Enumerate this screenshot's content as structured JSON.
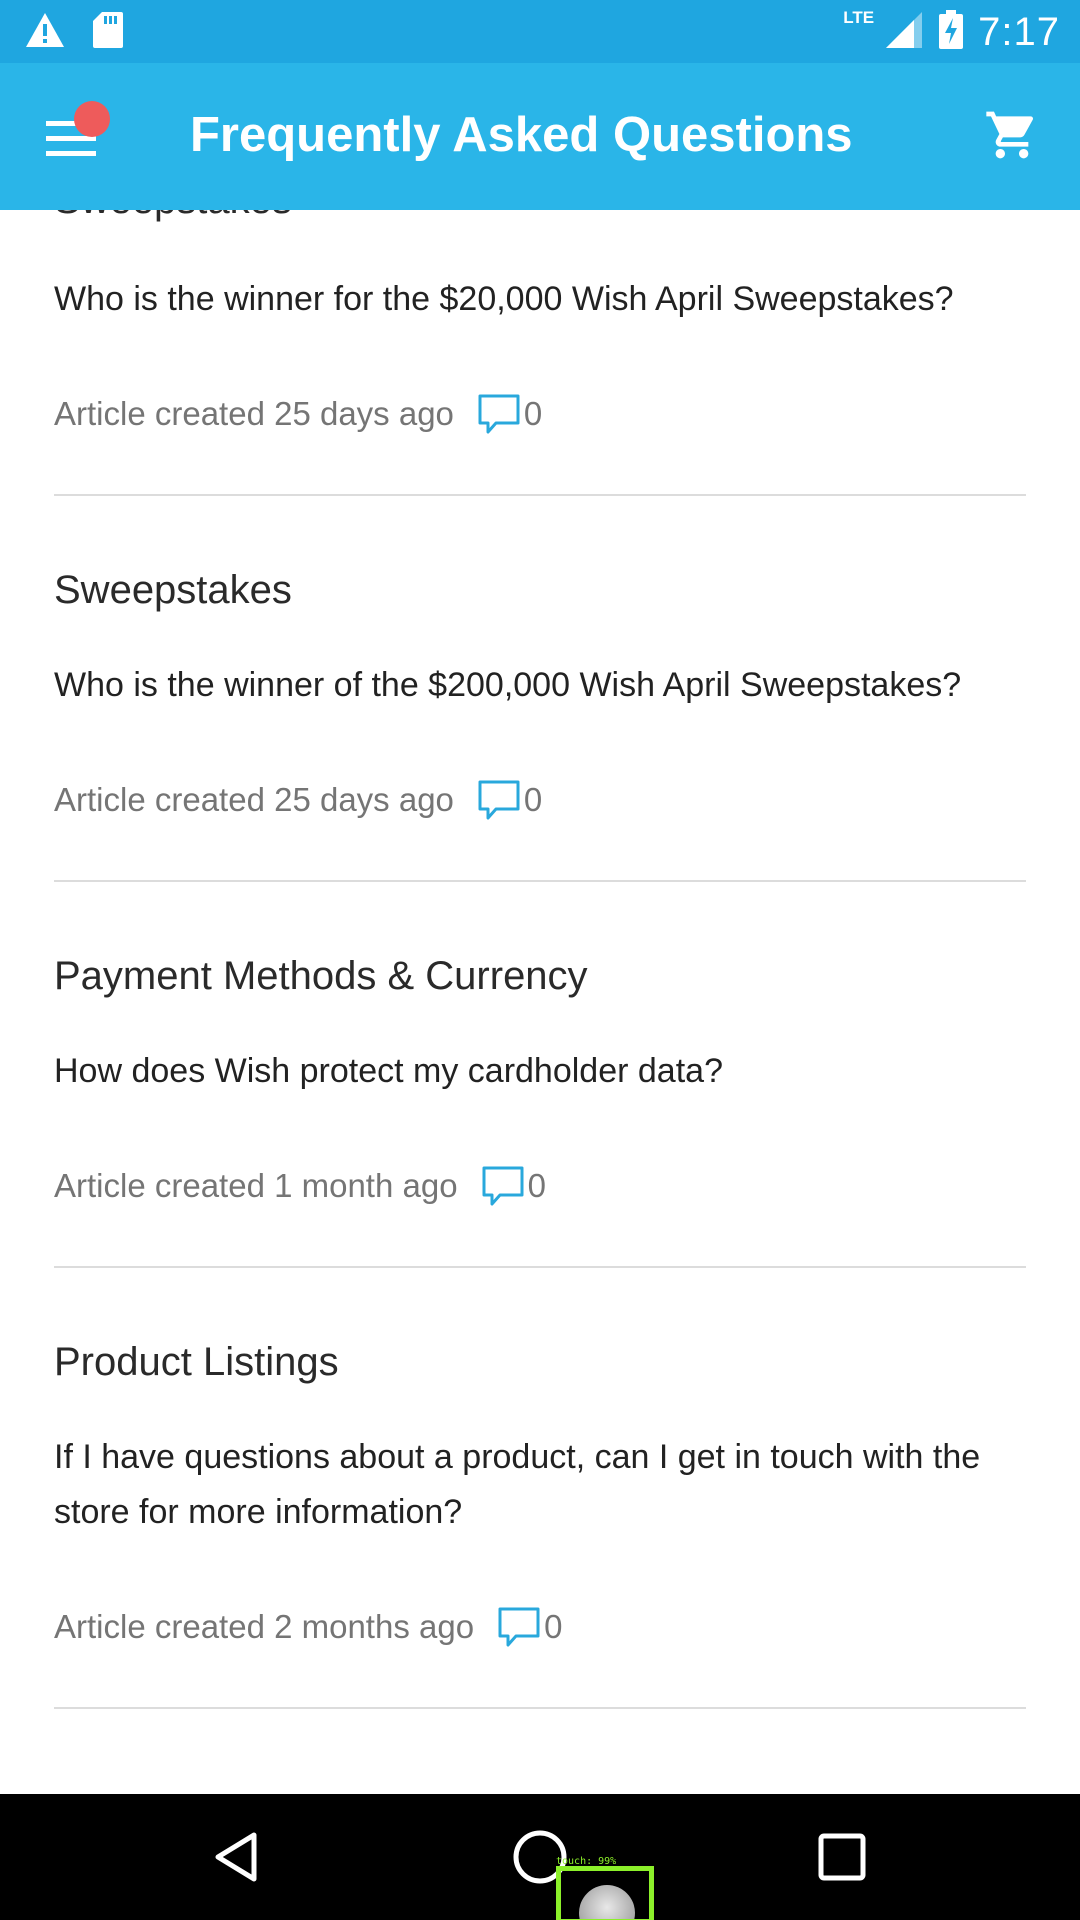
{
  "status_bar": {
    "time": "7:17",
    "network": "LTE",
    "icons_left": [
      "warning-icon",
      "sd-card-icon"
    ],
    "icons_right": [
      "signal-icon",
      "battery-charging-icon"
    ]
  },
  "app_bar": {
    "title": "Frequently Asked Questions",
    "menu_icon": "hamburger-menu-icon",
    "cart_icon": "shopping-cart-icon",
    "notification_dot_color": "#ee5b5b"
  },
  "articles": [
    {
      "category": "Sweepstakes",
      "question": "Who is the winner for the $20,000 Wish April Sweepstakes?",
      "meta": "Article created 25 days ago",
      "comments": "0"
    },
    {
      "category": "Sweepstakes",
      "question": "Who is the winner of the $200,000 Wish April Sweepstakes?",
      "meta": "Article created 25 days ago",
      "comments": "0"
    },
    {
      "category": "Payment Methods & Currency",
      "question": "How does Wish protect my cardholder data?",
      "meta": "Article created 1 month ago",
      "comments": "0"
    },
    {
      "category": "Product Listings",
      "question": "If I have questions about a product, can I get in touch with the store for more information?",
      "meta": "Article created 2 months ago",
      "comments": "0"
    }
  ],
  "nav_bar": {
    "back_icon": "back-triangle-icon",
    "home_icon": "home-circle-icon",
    "recents_icon": "recents-square-icon"
  },
  "overlay": {
    "touch_label": "touch: 99%"
  },
  "colors": {
    "status_bar": "#1fa6e0",
    "app_bar": "#2ab5e8",
    "accent": "#2ab5e8",
    "comment_icon": "#29a8dc"
  }
}
